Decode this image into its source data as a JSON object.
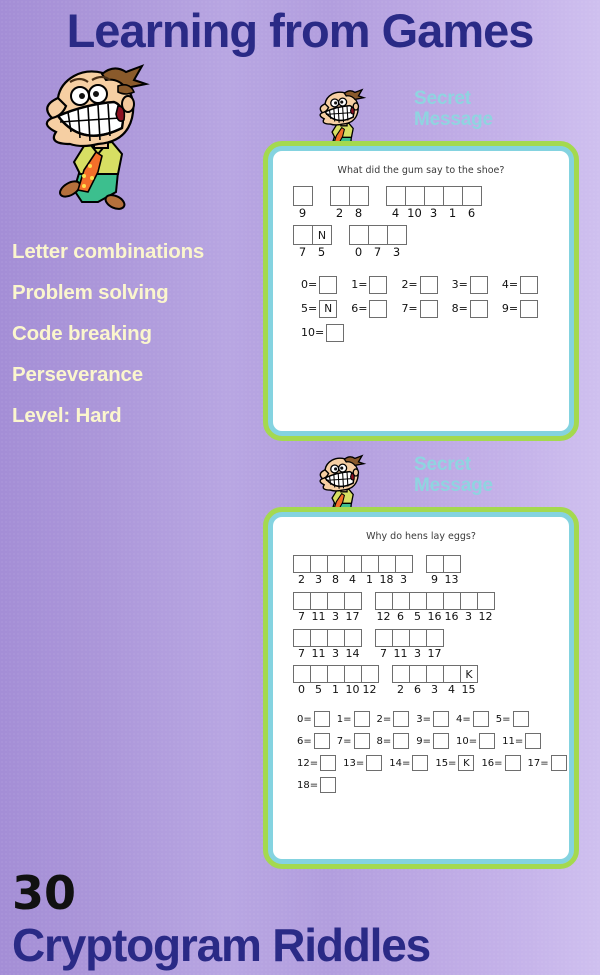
{
  "header": {
    "title": "Learning from Games",
    "title_color": "#2a2a86"
  },
  "features": {
    "items": [
      "Letter combinations",
      "Problem solving",
      "Code breaking",
      "Perseverance",
      "Level: Hard"
    ],
    "text_color": "#fbf6cd"
  },
  "footer": {
    "count": "30",
    "title": "Cryptogram Riddles"
  },
  "cards": [
    {
      "label_line1": "Secret",
      "label_line2": "Message",
      "label_color": "#8fd4e0",
      "border_outer_color": "#a4d94f",
      "border_inner_color": "#84d3e0",
      "question": "What did the gum say to the shoe?",
      "rows": [
        {
          "words": [
            {
              "cells": [
                {
                  "letter": "",
                  "number": "9"
                }
              ]
            },
            {
              "cells": [
                {
                  "letter": "",
                  "number": "2"
                },
                {
                  "letter": "",
                  "number": "8"
                }
              ]
            },
            {
              "cells": [
                {
                  "letter": "",
                  "number": "4"
                },
                {
                  "letter": "",
                  "number": "10"
                },
                {
                  "letter": "",
                  "number": "3"
                },
                {
                  "letter": "",
                  "number": "1"
                },
                {
                  "letter": "",
                  "number": "6"
                }
              ]
            }
          ]
        },
        {
          "words": [
            {
              "cells": [
                {
                  "letter": "",
                  "number": "7"
                },
                {
                  "letter": "N",
                  "number": "5"
                }
              ]
            },
            {
              "cells": [
                {
                  "letter": "",
                  "number": "0"
                },
                {
                  "letter": "",
                  "number": "7"
                },
                {
                  "letter": "",
                  "number": "3"
                }
              ]
            }
          ]
        }
      ],
      "legend_rows": [
        [
          {
            "key": "0=",
            "value": ""
          },
          {
            "key": "1=",
            "value": ""
          },
          {
            "key": "2=",
            "value": ""
          },
          {
            "key": "3=",
            "value": ""
          },
          {
            "key": "4=",
            "value": ""
          }
        ],
        [
          {
            "key": "5=",
            "value": "N"
          },
          {
            "key": "6=",
            "value": ""
          },
          {
            "key": "7=",
            "value": ""
          },
          {
            "key": "8=",
            "value": ""
          },
          {
            "key": "9=",
            "value": ""
          }
        ],
        [
          {
            "key": "10=",
            "value": ""
          }
        ]
      ]
    },
    {
      "label_line1": "Secret",
      "label_line2": "Message",
      "label_color": "#8fd4e0",
      "border_outer_color": "#a4d94f",
      "border_inner_color": "#84d3e0",
      "question": "Why do hens lay eggs?",
      "rows": [
        {
          "words": [
            {
              "cells": [
                {
                  "letter": "",
                  "number": "2"
                },
                {
                  "letter": "",
                  "number": "3"
                },
                {
                  "letter": "",
                  "number": "8"
                },
                {
                  "letter": "",
                  "number": "4"
                },
                {
                  "letter": "",
                  "number": "1"
                },
                {
                  "letter": "",
                  "number": "18"
                },
                {
                  "letter": "",
                  "number": "3"
                }
              ]
            },
            {
              "cells": [
                {
                  "letter": "",
                  "number": "9"
                },
                {
                  "letter": "",
                  "number": "13"
                }
              ]
            }
          ]
        },
        {
          "words": [
            {
              "cells": [
                {
                  "letter": "",
                  "number": "7"
                },
                {
                  "letter": "",
                  "number": "11"
                },
                {
                  "letter": "",
                  "number": "3"
                },
                {
                  "letter": "",
                  "number": "17"
                }
              ]
            },
            {
              "cells": [
                {
                  "letter": "",
                  "number": "12"
                },
                {
                  "letter": "",
                  "number": "6"
                },
                {
                  "letter": "",
                  "number": "5"
                },
                {
                  "letter": "",
                  "number": "16"
                },
                {
                  "letter": "",
                  "number": "16"
                },
                {
                  "letter": "",
                  "number": "3"
                },
                {
                  "letter": "",
                  "number": "12"
                }
              ]
            }
          ]
        },
        {
          "words": [
            {
              "cells": [
                {
                  "letter": "",
                  "number": "7"
                },
                {
                  "letter": "",
                  "number": "11"
                },
                {
                  "letter": "",
                  "number": "3"
                },
                {
                  "letter": "",
                  "number": "14"
                }
              ]
            },
            {
              "cells": [
                {
                  "letter": "",
                  "number": "7"
                },
                {
                  "letter": "",
                  "number": "11"
                },
                {
                  "letter": "",
                  "number": "3"
                },
                {
                  "letter": "",
                  "number": "17"
                }
              ]
            }
          ]
        },
        {
          "words": [
            {
              "cells": [
                {
                  "letter": "",
                  "number": "0"
                },
                {
                  "letter": "",
                  "number": "5"
                },
                {
                  "letter": "",
                  "number": "1"
                },
                {
                  "letter": "",
                  "number": "10"
                },
                {
                  "letter": "",
                  "number": "12"
                }
              ]
            },
            {
              "cells": [
                {
                  "letter": "",
                  "number": "2"
                },
                {
                  "letter": "",
                  "number": "6"
                },
                {
                  "letter": "",
                  "number": "3"
                },
                {
                  "letter": "",
                  "number": "4"
                },
                {
                  "letter": "K",
                  "number": "15"
                }
              ]
            }
          ]
        }
      ],
      "legend_rows": [
        [
          {
            "key": "0=",
            "value": ""
          },
          {
            "key": "1=",
            "value": ""
          },
          {
            "key": "2=",
            "value": ""
          },
          {
            "key": "3=",
            "value": ""
          },
          {
            "key": "4=",
            "value": ""
          },
          {
            "key": "5=",
            "value": ""
          }
        ],
        [
          {
            "key": "6=",
            "value": ""
          },
          {
            "key": "7=",
            "value": ""
          },
          {
            "key": "8=",
            "value": ""
          },
          {
            "key": "9=",
            "value": ""
          },
          {
            "key": "10=",
            "value": ""
          },
          {
            "key": "11=",
            "value": ""
          }
        ],
        [
          {
            "key": "12=",
            "value": ""
          },
          {
            "key": "13=",
            "value": ""
          },
          {
            "key": "14=",
            "value": ""
          },
          {
            "key": "15=",
            "value": "K"
          },
          {
            "key": "16=",
            "value": ""
          },
          {
            "key": "17=",
            "value": ""
          }
        ],
        [
          {
            "key": "18=",
            "value": ""
          }
        ]
      ]
    }
  ],
  "mascots": [
    {
      "name": "grinning-man-large"
    },
    {
      "name": "grinning-man-small-card1"
    },
    {
      "name": "grinning-man-small-card2"
    }
  ]
}
